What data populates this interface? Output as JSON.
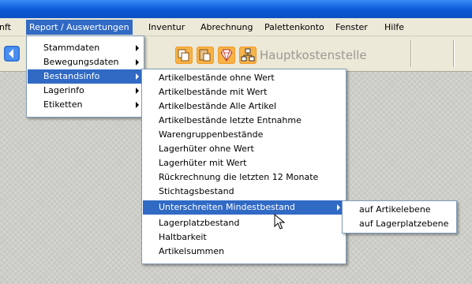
{
  "menubar": {
    "items": [
      {
        "label": "nft"
      },
      {
        "label": "Report / Auswertungen"
      },
      {
        "label": "Inventur"
      },
      {
        "label": "Abrechnung"
      },
      {
        "label": "Palettenkonto"
      },
      {
        "label": "Fenster"
      },
      {
        "label": "Hilfe"
      }
    ]
  },
  "toolbar": {
    "cost_center_label": "Hauptkostenstelle",
    "icons": [
      "nav-icon",
      "copy-icon",
      "paste-icon",
      "diamond-icon",
      "hierarchy-icon"
    ]
  },
  "report_menu": {
    "items": [
      {
        "label": "Stammdaten"
      },
      {
        "label": "Bewegungsdaten"
      },
      {
        "label": "Bestandsinfo"
      },
      {
        "label": "Lagerinfo"
      },
      {
        "label": "Etiketten"
      }
    ]
  },
  "bestandsinfo_menu": {
    "items": [
      {
        "label": "Artikelbestände ohne Wert"
      },
      {
        "label": "Artikelbestände mit Wert"
      },
      {
        "label": "Artikelbestände Alle Artikel"
      },
      {
        "label": "Artikelbestände letzte Entnahme"
      },
      {
        "label": "Warengruppenbestände"
      },
      {
        "label": "Lagerhüter ohne Wert"
      },
      {
        "label": "Lagerhüter mit Wert"
      },
      {
        "label": "Rückrechnung die letzten 12 Monate"
      },
      {
        "label": "Stichtagsbestand"
      },
      {
        "label": "Unterschreiten Mindestbestand"
      },
      {
        "label": "Lagerplatzbestand"
      },
      {
        "label": "Haltbarkeit"
      },
      {
        "label": "Artikelsummen"
      }
    ]
  },
  "mindestbestand_menu": {
    "items": [
      {
        "label": "auf Artikelebene"
      },
      {
        "label": "auf Lagerplatzebene"
      }
    ]
  },
  "colors": {
    "highlight": "#316ac5",
    "menubar_bg": "#ece9d8",
    "titlebar": "#0a58d6",
    "menu_border": "#7f9db9"
  }
}
